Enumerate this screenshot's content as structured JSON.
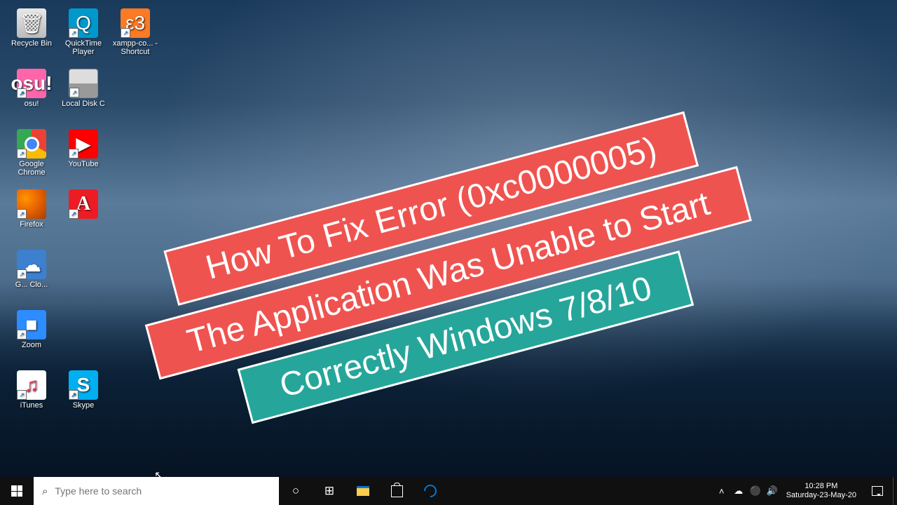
{
  "desktop_icons": [
    {
      "id": "recycle-bin",
      "label": "Recycle Bin",
      "shortcut": false
    },
    {
      "id": "quicktime",
      "label": "QuickTime Player",
      "shortcut": true
    },
    {
      "id": "xampp",
      "label": "xampp-co... - Shortcut",
      "shortcut": true
    },
    {
      "id": "osu",
      "label": "osu!",
      "shortcut": true
    },
    {
      "id": "local-disk",
      "label": "Local Disk C",
      "shortcut": true
    },
    {
      "id": "chrome",
      "label": "Google Chrome",
      "shortcut": true
    },
    {
      "id": "youtube",
      "label": "YouTube",
      "shortcut": true
    },
    {
      "id": "firefox",
      "label": "Firefox",
      "shortcut": true
    },
    {
      "id": "adobe",
      "label": "",
      "shortcut": true
    },
    {
      "id": "cloud",
      "label": "G... Clo...",
      "shortcut": true
    },
    {
      "id": "zoom",
      "label": "Zoom",
      "shortcut": true
    },
    {
      "id": "itunes",
      "label": "iTunes",
      "shortcut": true
    },
    {
      "id": "skype",
      "label": "Skype",
      "shortcut": true
    }
  ],
  "banners": {
    "line1": "How To Fix Error (0xc0000005)",
    "line2": "The Application Was Unable to Start",
    "line3": "Correctly Windows 7/8/10"
  },
  "taskbar": {
    "search_placeholder": "Type here to search"
  },
  "tray": {
    "time": "10:28 PM",
    "date": "Saturday-23-May-20"
  },
  "colors": {
    "banner_red": "#ef5350",
    "banner_green": "#26a69a",
    "taskbar_bg": "#101010"
  }
}
